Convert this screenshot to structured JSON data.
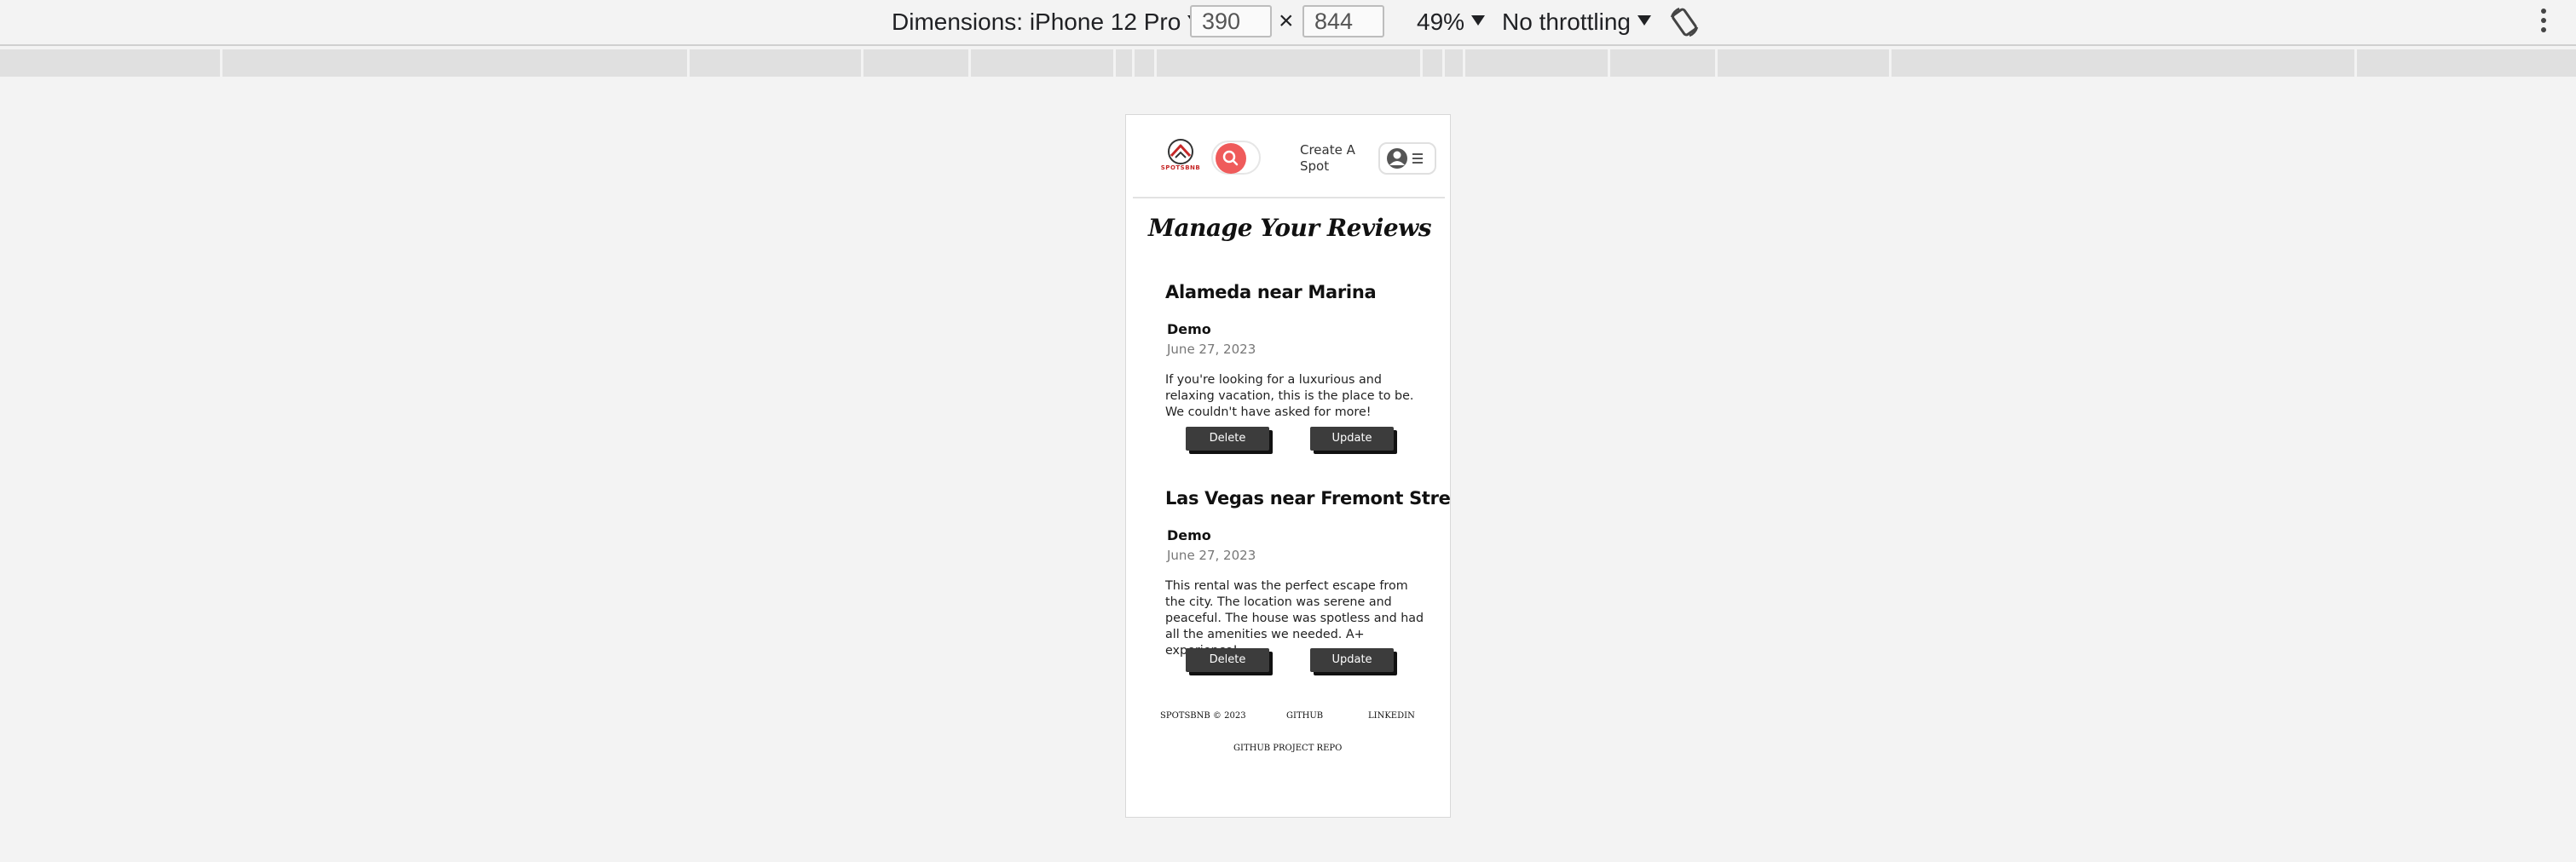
{
  "devtools": {
    "dimensions_label": "Dimensions: iPhone 12 Pro",
    "width_value": "390",
    "times": "×",
    "height_value": "844",
    "zoom_label": "49%",
    "throttling_label": "No throttling",
    "icons": [
      "caret-down-icon",
      "rotate-icon",
      "more-vert-icon"
    ]
  },
  "nav": {
    "logo_text": "SPOTSBNB",
    "create_spot": "Create A Spot",
    "icons": [
      "logo-icon",
      "search-icon",
      "user-circle-icon",
      "menu-icon"
    ]
  },
  "page": {
    "title": "Manage Your Reviews"
  },
  "reviews": [
    {
      "spot_name": "Alameda near Marina",
      "reviewer": "Demo",
      "date": "June 27, 2023",
      "text": "If you're looking for a luxurious and relaxing vacation, this is the place to be. We couldn't have asked for more!",
      "delete_label": "Delete",
      "update_label": "Update"
    },
    {
      "spot_name": "Las Vegas near Fremont Street",
      "reviewer": "Demo",
      "date": "June 27, 2023",
      "text": "This rental was the perfect escape from the city. The location was serene and peaceful. The house was spotless and had all the amenities we needed. A+ experience!",
      "delete_label": "Delete",
      "update_label": "Update"
    }
  ],
  "footer": {
    "copyright": "SPOTSBNB © 2023",
    "github": "GITHUB",
    "linkedin": "LINKEDIN",
    "repo": "GITHUB PROJECT REPO"
  },
  "colors": {
    "brand_red": "#ef5b5b",
    "button_dark": "#3c3c3c"
  }
}
